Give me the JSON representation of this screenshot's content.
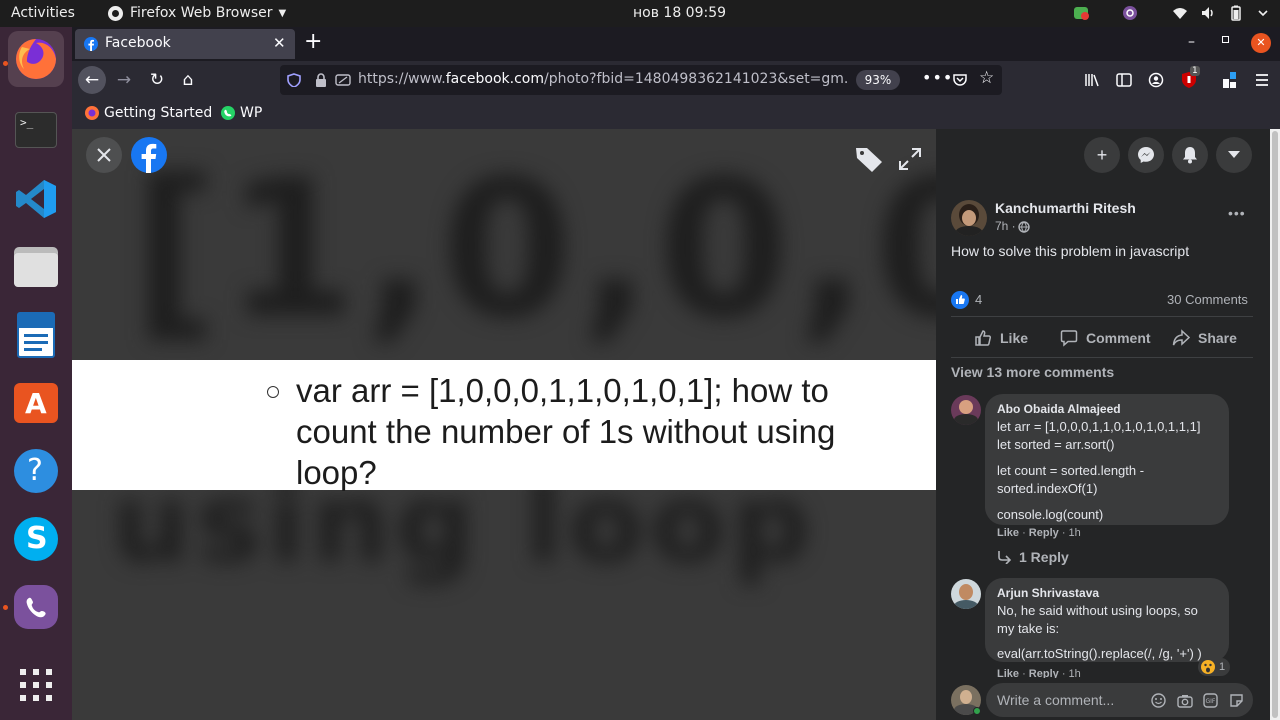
{
  "topbar": {
    "activities": "Activities",
    "app_name": "Firefox Web Browser",
    "clock": "нов 18  09:59"
  },
  "browser": {
    "tab_title": "Facebook",
    "url_domain_pre": "https://www.",
    "url_domain": "facebook.com",
    "url_rest": "/photo?fbid=1480498362141023&set=gm.",
    "zoom": "93%",
    "notification_count": "1",
    "bookmarks": [
      {
        "label": "Getting Started"
      },
      {
        "label": "WP"
      }
    ]
  },
  "photo": {
    "text": "var arr = [1,0,0,0,1,1,0,1,0,1]; how to count the number of 1s without using loop?"
  },
  "post": {
    "author": "Kanchumarthi Ritesh",
    "time": "7h ·",
    "body": "How to solve this problem in javascript",
    "reactions_count": "4",
    "comments_count": "30 Comments",
    "actions": {
      "like": "Like",
      "comment": "Comment",
      "share": "Share"
    },
    "view_more": "View 13 more comments"
  },
  "comments": [
    {
      "author": "Abo Obaida Almajeed",
      "lines": [
        "let arr = [1,0,0,0,1,1,0,1,0,1,0,1,1,1]",
        "let sorted = arr.sort()",
        "let count = sorted.length -",
        "sorted.indexOf(1)",
        "console.log(count)"
      ],
      "like": "Like",
      "reply": "Reply",
      "time": "1h",
      "replies_link": "1 Reply"
    },
    {
      "author": "Arjun Shrivastava",
      "lines": [
        "No, he said without using loops, so",
        "my take is:",
        "eval(arr.toString().replace(/, /g, '+') )"
      ],
      "like": "Like",
      "reply": "Reply",
      "time": "1h",
      "reaction_count": "1"
    }
  ],
  "composer": {
    "placeholder": "Write a comment..."
  },
  "colors": {
    "accent_blue": "#1877f2",
    "firefox_orange": "#ff7139",
    "ubuntu_orange": "#e95420"
  }
}
